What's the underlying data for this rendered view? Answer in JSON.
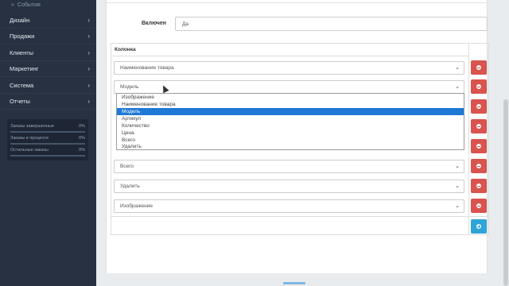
{
  "sidebar": {
    "sub_item": "События",
    "items": [
      {
        "label": "Дизайн"
      },
      {
        "label": "Продажи"
      },
      {
        "label": "Клиенты"
      },
      {
        "label": "Маркетинг"
      },
      {
        "label": "Система"
      },
      {
        "label": "Отчеты"
      }
    ],
    "stats": [
      {
        "label": "Заказы завершенные",
        "value": "0%",
        "progress": 0
      },
      {
        "label": "Заказы в процессе",
        "value": "0%",
        "progress": 0
      },
      {
        "label": "Остальные заказы",
        "value": "0%",
        "progress": 0
      }
    ]
  },
  "form": {
    "enabled_label": "Включен",
    "enabled_value": "Да",
    "column_header": "Колонка",
    "rows": [
      {
        "value": "Наименование товара"
      },
      {
        "value": "Модель"
      },
      {
        "value": ""
      },
      {
        "value": ""
      },
      {
        "value": ""
      },
      {
        "value": "Всего"
      },
      {
        "value": "Удалить"
      },
      {
        "value": "Изображение"
      }
    ],
    "dropdown_options": [
      "Изображение",
      "Наименование товара",
      "Модель",
      "Артикул",
      "Количество",
      "Цена",
      "Всего",
      "Удалить"
    ],
    "dropdown_selected": "Модель"
  },
  "colors": {
    "sidebar_bg": "#273142",
    "danger": "#d9534f",
    "primary": "#2fa4d8",
    "selection": "#1e78d6"
  }
}
